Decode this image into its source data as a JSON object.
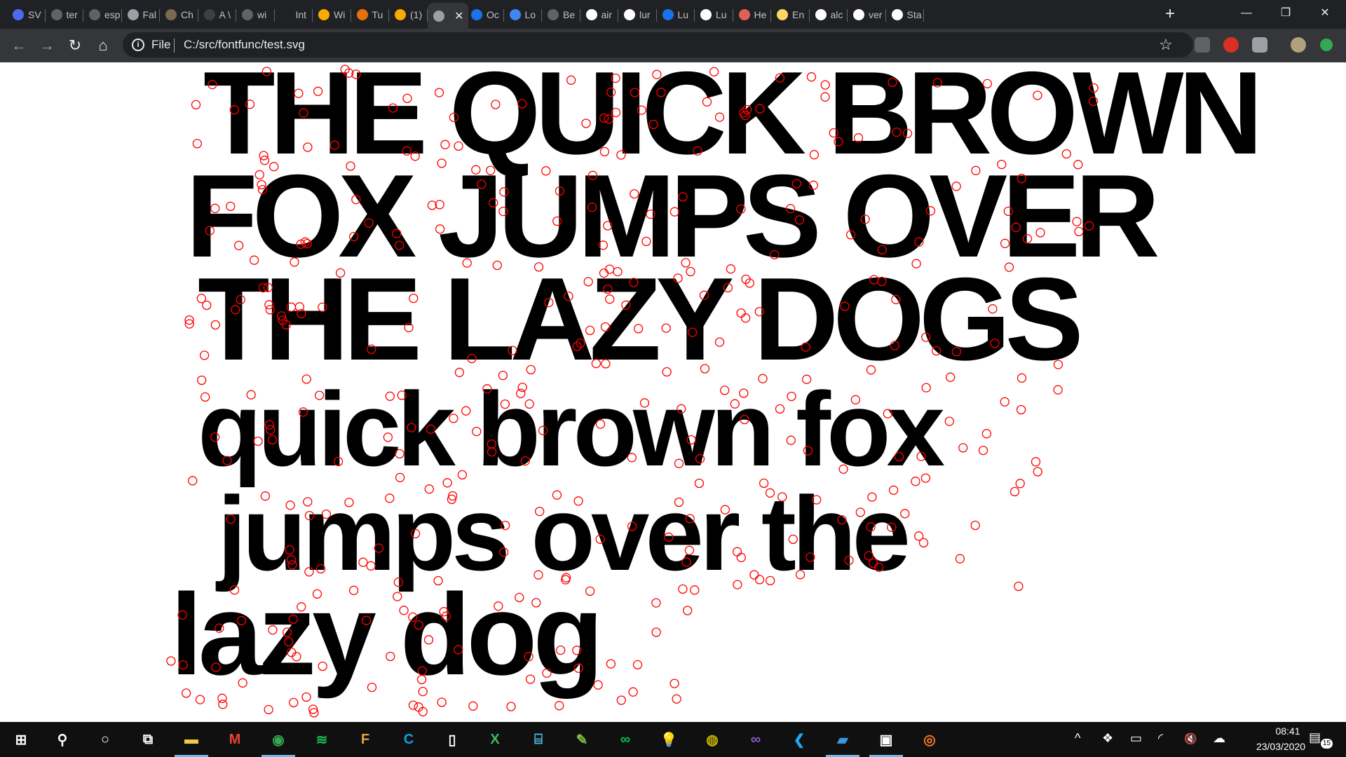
{
  "browser": {
    "tabs": [
      {
        "label": "SV",
        "icon": "svg-icon",
        "color": "#4f6bed"
      },
      {
        "label": "ter",
        "icon": "github-icon",
        "color": "#5f6368"
      },
      {
        "label": "esp",
        "icon": "github-icon",
        "color": "#5f6368"
      },
      {
        "label": "Fal",
        "icon": "globe-icon",
        "color": "#9aa0a6"
      },
      {
        "label": "Ch",
        "icon": "site-icon",
        "color": "#7a6a4f"
      },
      {
        "label": "A \\",
        "icon": "site-icon",
        "color": "#3c4043"
      },
      {
        "label": "wi",
        "icon": "github-icon",
        "color": "#5f6368"
      },
      {
        "label": "Int",
        "icon": "graduation-cap-icon",
        "color": "#202124"
      },
      {
        "label": "Wi",
        "icon": "g-icon",
        "color": "#f9ab00"
      },
      {
        "label": "Tu",
        "icon": "pinwheel-icon",
        "color": "#e8710a"
      },
      {
        "label": "(1)",
        "icon": "g-icon",
        "color": "#f9ab00"
      },
      {
        "label": "",
        "icon": "globe-icon",
        "color": "#9aa0a6"
      },
      {
        "label": "Oc",
        "icon": "drive-icon",
        "color": "#1a73e8"
      },
      {
        "label": "Lo",
        "icon": "shield-icon",
        "color": "#4285f4"
      },
      {
        "label": "Be",
        "icon": "h-icon",
        "color": "#5f6368"
      },
      {
        "label": "air",
        "icon": "google-icon",
        "color": "#ffffff"
      },
      {
        "label": "lur",
        "icon": "google-icon",
        "color": "#ffffff"
      },
      {
        "label": "Lu",
        "icon": "l-icon",
        "color": "#1a73e8"
      },
      {
        "label": "Lu",
        "icon": "google-icon",
        "color": "#ffffff"
      },
      {
        "label": "He",
        "icon": "lips-icon",
        "color": "#e06055"
      },
      {
        "label": "En",
        "icon": "bookmark-icon",
        "color": "#fdd663"
      },
      {
        "label": "alc",
        "icon": "google-icon",
        "color": "#ffffff"
      },
      {
        "label": "ver",
        "icon": "google-icon",
        "color": "#ffffff"
      },
      {
        "label": "Sta",
        "icon": "wikipedia-icon",
        "color": "#ffffff"
      }
    ],
    "active_tab_index": 11,
    "new_tab_label": "+",
    "window_controls": {
      "minimize": "—",
      "restore": "❐",
      "close": "✕"
    },
    "address": {
      "scheme_label": "File",
      "url": "C:/src/fontfunc/test.svg"
    }
  },
  "svg_content": {
    "lines": [
      "THE QUICK BROWN",
      "FOX JUMPS OVER",
      "THE LAZY DOGS",
      "quick brown fox",
      "jumps over the",
      "lazy dog"
    ],
    "fill_color": "#000000",
    "point_color": "#ff0000"
  },
  "taskbar": {
    "apps": [
      {
        "name": "start-button",
        "glyph": "⊞",
        "color": "#ffffff",
        "running": false
      },
      {
        "name": "search-button",
        "glyph": "⚲",
        "color": "#ffffff",
        "running": false
      },
      {
        "name": "cortana-button",
        "glyph": "○",
        "color": "#ffffff",
        "running": false
      },
      {
        "name": "task-view-button",
        "glyph": "⧉",
        "color": "#ffffff",
        "running": false
      },
      {
        "name": "file-explorer-icon",
        "glyph": "▬",
        "color": "#f2c744",
        "running": true
      },
      {
        "name": "gmail-icon",
        "glyph": "M",
        "color": "#ea4335",
        "running": false
      },
      {
        "name": "chrome-icon",
        "glyph": "◉",
        "color": "#34a853",
        "running": true
      },
      {
        "name": "spotify-icon",
        "glyph": "≋",
        "color": "#1db954",
        "running": false
      },
      {
        "name": "document-app-icon",
        "glyph": "F",
        "color": "#e8a23a",
        "running": false
      },
      {
        "name": "c-app-icon",
        "glyph": "C",
        "color": "#0aa1dd",
        "running": false
      },
      {
        "name": "file-icon",
        "glyph": "▯",
        "color": "#ffffff",
        "running": false
      },
      {
        "name": "xmind-icon",
        "glyph": "X",
        "color": "#3dbb5b",
        "running": false
      },
      {
        "name": "terminal-icon",
        "glyph": "⌸",
        "color": "#4ec0e9",
        "running": false
      },
      {
        "name": "notepad-icon",
        "glyph": "✎",
        "color": "#7cc242",
        "running": false
      },
      {
        "name": "infinity-app-icon",
        "glyph": "∞",
        "color": "#00c853",
        "running": false
      },
      {
        "name": "bulb-icon",
        "glyph": "💡",
        "color": "#f9d71c",
        "running": false
      },
      {
        "name": "globe-app-icon",
        "glyph": "◍",
        "color": "#c8b400",
        "running": false
      },
      {
        "name": "visual-studio-icon",
        "glyph": "∞",
        "color": "#865fc5",
        "running": false
      },
      {
        "name": "vscode-icon",
        "glyph": "❮",
        "color": "#22a7f2",
        "running": false
      },
      {
        "name": "azure-storage-icon",
        "glyph": "▰",
        "color": "#3a96dd",
        "running": true
      },
      {
        "name": "photos-icon",
        "glyph": "▣",
        "color": "#ffffff",
        "running": true
      },
      {
        "name": "blender-icon",
        "glyph": "◎",
        "color": "#f5792a",
        "running": false
      }
    ],
    "tray": {
      "chevron": "^",
      "dropbox": "❖",
      "battery": "▭",
      "wifi": "◜",
      "volume": "🔇",
      "cloud": "☁"
    },
    "clock": {
      "time": "08:41",
      "date": "23/03/2020"
    },
    "notifications": {
      "glyph": "▤",
      "count": "15"
    }
  }
}
